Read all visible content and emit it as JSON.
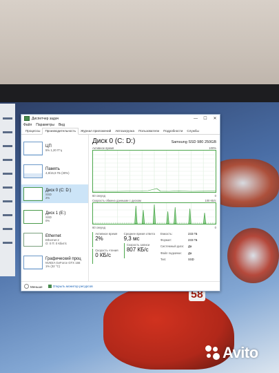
{
  "window": {
    "title": "Диспетчер задач",
    "controls": {
      "minimize": "—",
      "maximize": "☐",
      "close": "✕"
    }
  },
  "menu": [
    "Файл",
    "Параметры",
    "Вид"
  ],
  "tabs": [
    {
      "label": "Процессы",
      "active": false
    },
    {
      "label": "Производительность",
      "active": true
    },
    {
      "label": "Журнал приложений",
      "active": false
    },
    {
      "label": "Автозагрузка",
      "active": false
    },
    {
      "label": "Пользователи",
      "active": false
    },
    {
      "label": "Подробности",
      "active": false
    },
    {
      "label": "Службы",
      "active": false
    }
  ],
  "sidebar": [
    {
      "name": "ЦП",
      "sub1": "5% 1,20 ГГц",
      "sub2": "",
      "selected": false,
      "fill": 0.05
    },
    {
      "name": "Память",
      "sub1": "4,8/15,8 ГБ (30%)",
      "sub2": "",
      "selected": false,
      "fill": 0.3
    },
    {
      "name": "Диск 0 (C: D:)",
      "sub1": "SSD",
      "sub2": "2%",
      "selected": true,
      "fill": 0.02
    },
    {
      "name": "Диск 1 (E:)",
      "sub1": "SSD",
      "sub2": "0%",
      "selected": false,
      "fill": 0.0
    },
    {
      "name": "Ethernet",
      "sub1": "Ethernet 2",
      "sub2": "О: 0 П: 0 Кбит/с",
      "selected": false,
      "fill": 0.0
    },
    {
      "name": "Графический проц",
      "sub1": "NVIDIA GeForce GTX 166",
      "sub2": "1% (32 °C)",
      "selected": false,
      "fill": 0.01
    }
  ],
  "detail": {
    "title": "Диск 0 (C: D:)",
    "model": "Samsung SSD 980 250GB",
    "graph1": {
      "label": "Активное время",
      "max": "100%",
      "xlabel": "60 секунд",
      "xend": "0"
    },
    "graph2": {
      "label": "Скорость обмена данными с диском",
      "max": "100 КБ/с",
      "xlabel": "60 секунд",
      "xend": "0"
    },
    "stats": {
      "active_time_label": "Активное время",
      "active_time": "2%",
      "resp_label": "Среднее время ответа",
      "resp": "9,3 мс",
      "read_label": "Скорость чтения",
      "read": "0 КБ/с",
      "write_label": "Скорость записи",
      "write": "807 КБ/с"
    },
    "props": [
      {
        "k": "Емкость:",
        "v": "233 ГБ"
      },
      {
        "k": "Формат:",
        "v": "233 ГБ"
      },
      {
        "k": "Системный диск:",
        "v": "Да"
      },
      {
        "k": "Файл подкачки:",
        "v": "Да"
      },
      {
        "k": "Тип:",
        "v": "SSD"
      }
    ]
  },
  "footer": {
    "less": "Меньше",
    "monitor": "Открыть монитор ресурсов"
  },
  "background": {
    "tail_number": "58",
    "watermark": "Avito"
  },
  "colors": {
    "accent": "#4aa64a",
    "selected": "#cce4f7",
    "link": "#1a64b8"
  }
}
